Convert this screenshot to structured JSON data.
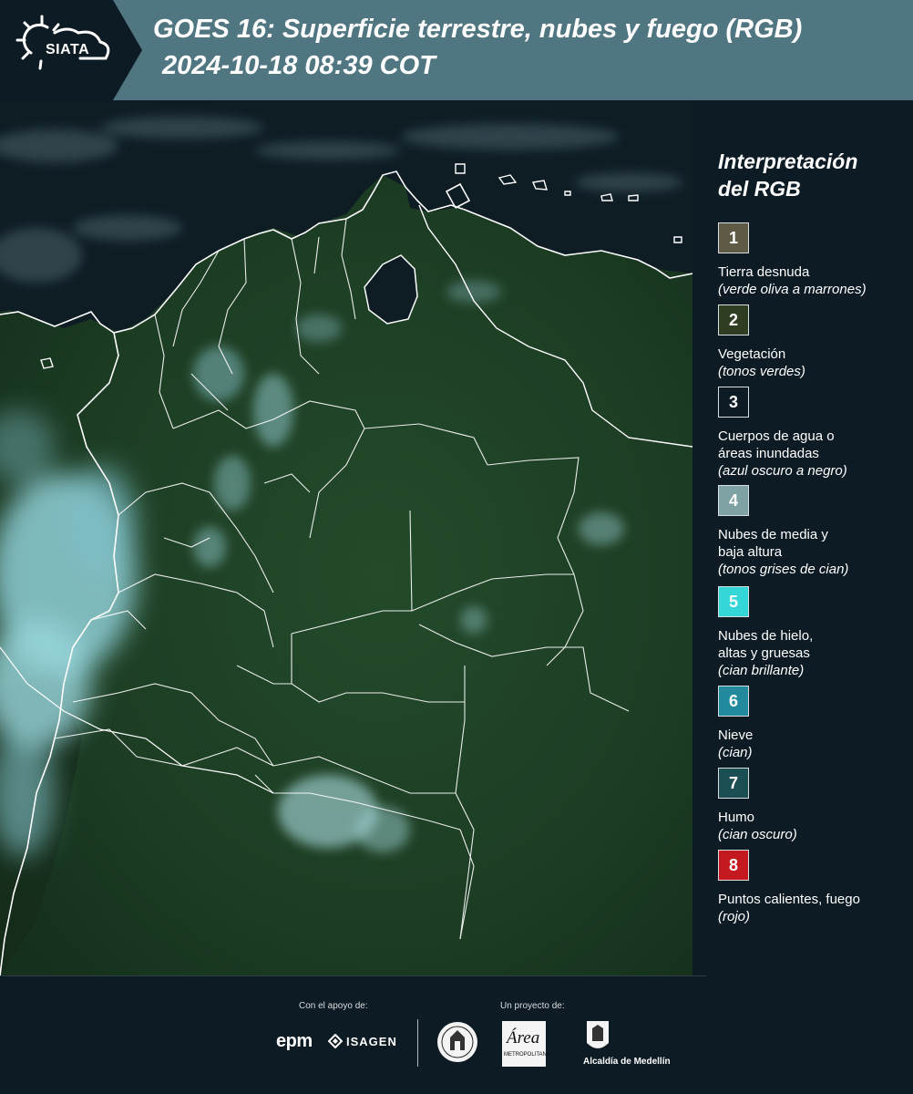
{
  "header": {
    "logo_text": "SIATA",
    "title_line1": "GOES 16: Superficie terrestre, nubes y fuego (RGB)",
    "title_line2": "2024-10-18 08:39 COT"
  },
  "map": {
    "icon": "satellite-map",
    "land_color": "#1d3d24",
    "ocean_color": "#0d1b22",
    "cloud_color": "#9fd3d8",
    "border_color": "#ffffff"
  },
  "legend": {
    "title_line1": "Interpretación",
    "title_line2": "del RGB",
    "items": [
      {
        "number": "1",
        "color": "#5f5a45",
        "label_lines": [
          "Tierra desnuda"
        ],
        "note": "(verde oliva a marrones)"
      },
      {
        "number": "2",
        "color": "#2f3d22",
        "label_lines": [
          "Vegetación"
        ],
        "note": "(tonos verdes)"
      },
      {
        "number": "3",
        "color": "#0c1b24",
        "label_lines": [
          "Cuerpos de agua o",
          "áreas inundadas"
        ],
        "note": "(azul oscuro a negro)"
      },
      {
        "number": "4",
        "color": "#7fa3a4",
        "label_lines": [
          "Nubes de media y",
          "baja altura"
        ],
        "note": "(tonos grises de cian)"
      },
      {
        "number": "5",
        "color": "#35d6d8",
        "label_lines": [
          "Nubes de hielo,",
          "altas y gruesas"
        ],
        "note": "(cian brillante)"
      },
      {
        "number": "6",
        "color": "#238a9d",
        "label_lines": [
          "Nieve"
        ],
        "note": "(cian)"
      },
      {
        "number": "7",
        "color": "#1b4f54",
        "label_lines": [
          "Humo"
        ],
        "note": "(cian oscuro)"
      },
      {
        "number": "8",
        "color": "#c41a1f",
        "label_lines": [
          "Puntos calientes, fuego"
        ],
        "note": "(rojo)"
      }
    ]
  },
  "footer": {
    "support_caption": "Con el apoyo de:",
    "project_caption": "Un proyecto de:",
    "epm": "epm",
    "isagen": "ISAGEN",
    "area_word": "Área",
    "area_sub": "METROPOLITANA",
    "alcaldia": "Alcaldía de Medellín"
  }
}
